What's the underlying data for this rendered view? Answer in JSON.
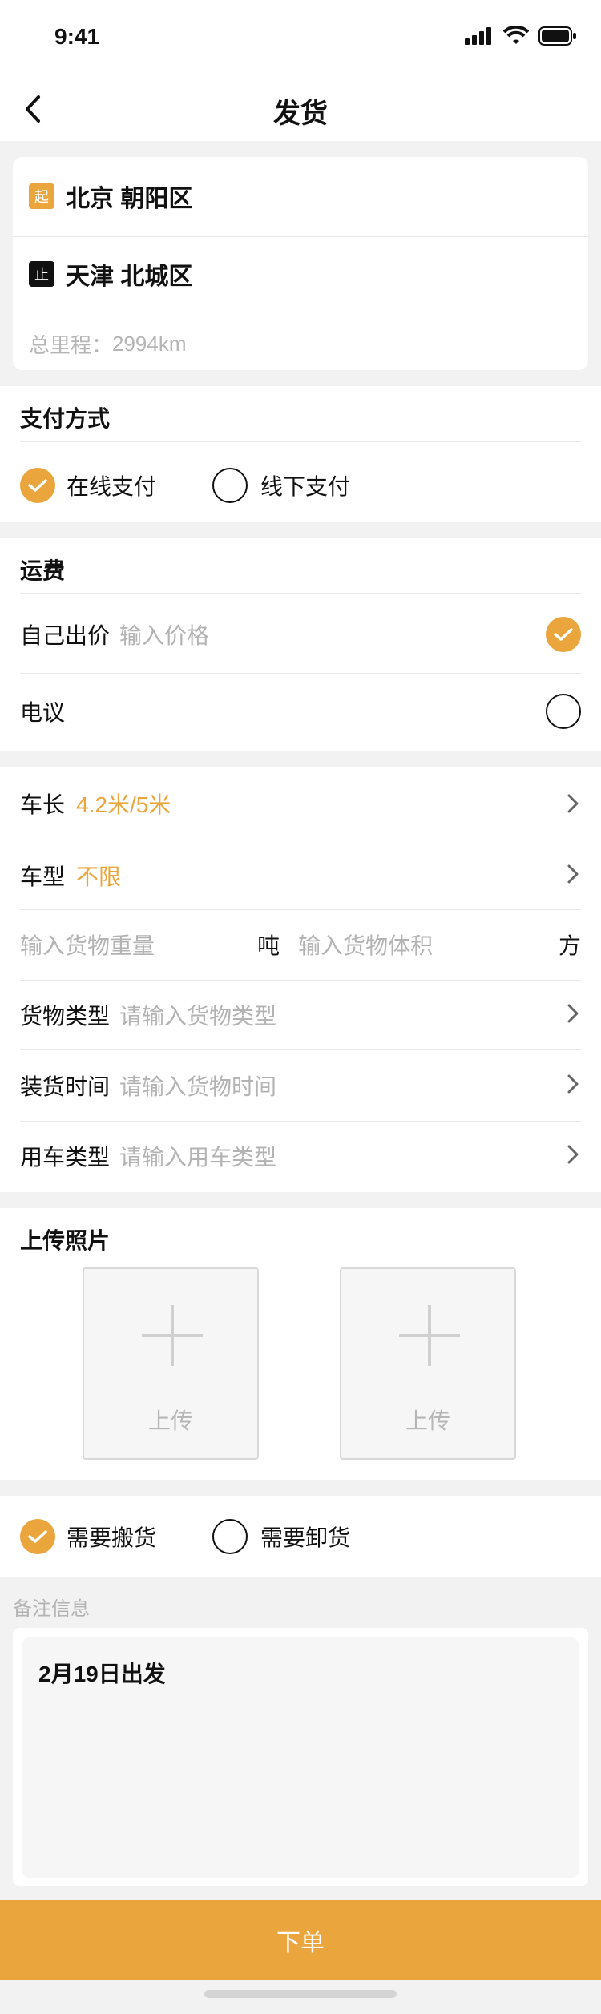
{
  "status_bar": {
    "time": "9:41"
  },
  "nav": {
    "title": "发货"
  },
  "route": {
    "start_badge": "起",
    "start": "北京 朝阳区",
    "end_badge": "止",
    "end": "天津 北城区",
    "distance_label": "总里程：",
    "distance_value": "2994km"
  },
  "payment": {
    "title": "支付方式",
    "options": [
      {
        "label": "在线支付",
        "selected": true
      },
      {
        "label": "线下支付",
        "selected": false
      }
    ]
  },
  "freight": {
    "title": "运费",
    "self_price_label": "自己出价",
    "self_price_placeholder": "输入价格",
    "negotiable_label": "电议"
  },
  "vehicle": {
    "length_label": "车长",
    "length_value": "4.2米/5米",
    "type_label": "车型",
    "type_value": "不限",
    "weight_placeholder": "输入货物重量",
    "weight_unit": "吨",
    "volume_placeholder": "输入货物体积",
    "volume_unit": "方",
    "cargo_type_label": "货物类型",
    "cargo_type_placeholder": "请输入货物类型",
    "loading_time_label": "装货时间",
    "loading_time_placeholder": "请输入货物时间",
    "vehicle_use_label": "用车类型",
    "vehicle_use_placeholder": "请输入用车类型"
  },
  "upload": {
    "title": "上传照片",
    "button_label_1": "上传",
    "button_label_2": "上传"
  },
  "services": {
    "options": [
      {
        "label": "需要搬货",
        "selected": true
      },
      {
        "label": "需要卸货",
        "selected": false
      }
    ]
  },
  "remark": {
    "title": "备注信息",
    "content": "2月19日出发"
  },
  "submit_label": "下单",
  "colors": {
    "accent": "#EBA53D",
    "background": "#F2F2F2",
    "text": "#111111",
    "placeholder": "#B3B3B3"
  }
}
